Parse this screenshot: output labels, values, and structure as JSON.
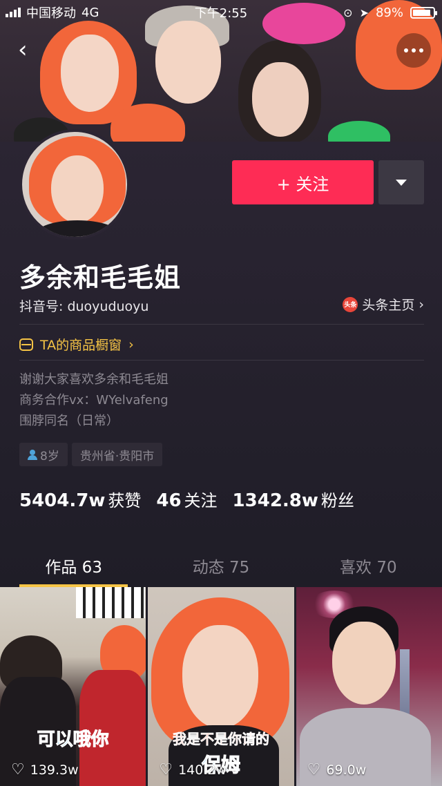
{
  "status_bar": {
    "carrier": "中国移动",
    "network": "4G",
    "time": "下午2:55",
    "battery": "89%",
    "battery_level": 0.89
  },
  "profile": {
    "name": "多余和毛毛姐",
    "douyin_id": "抖音号: duoyuduoyu",
    "toutiao_link": "头条主页",
    "toutiao_badge": "头条",
    "follow_label": "+ 关注",
    "shop_label": "TA的商品橱窗",
    "bio": [
      "谢谢大家喜欢多余和毛毛姐",
      "商务合作vx：WYelvafeng",
      "围脖同名（日常）"
    ],
    "tags": {
      "age": "8岁",
      "location": "贵州省·贵阳市"
    },
    "stats": [
      {
        "value": "5404.7w",
        "label": "获赞"
      },
      {
        "value": "46",
        "label": "关注"
      },
      {
        "value": "1342.8w",
        "label": "粉丝"
      }
    ]
  },
  "tabs": [
    {
      "label": "作品 63",
      "active": true
    },
    {
      "label": "动态 75",
      "active": false
    },
    {
      "label": "喜欢 70",
      "active": false
    }
  ],
  "videos": [
    {
      "likes": "139.3w",
      "caption": "可以哦你"
    },
    {
      "likes": "140.2w",
      "caption": "我是不是你请的",
      "caption2": "保姆"
    },
    {
      "likes": "69.0w"
    }
  ],
  "colors": {
    "accent": "#fe2c55",
    "highlight": "#f6c445",
    "background": "#1f1d27"
  }
}
